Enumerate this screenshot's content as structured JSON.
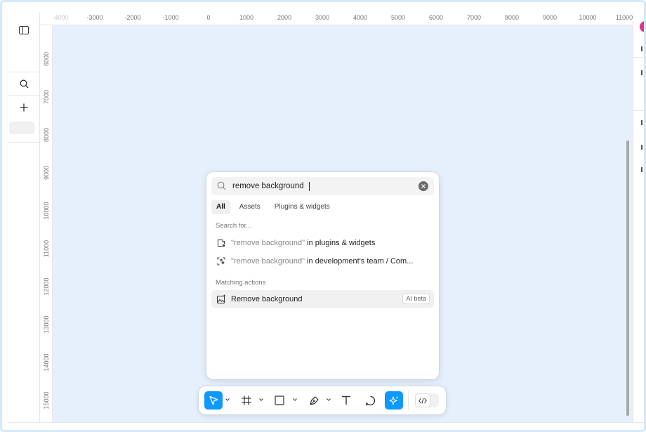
{
  "ruler": {
    "top_ticks": [
      "-4000",
      "-3000",
      "-2000",
      "-1000",
      "0",
      "1000",
      "2000",
      "3000",
      "4000",
      "5000",
      "6000",
      "7000",
      "8000",
      "9000",
      "10000",
      "11000"
    ],
    "left_ticks": [
      "6000",
      "7000",
      "8000",
      "9000",
      "10000",
      "11000",
      "12000",
      "13000",
      "14000",
      "15000"
    ]
  },
  "left_panel": {
    "icons": [
      "panel-toggle-icon",
      "search-icon",
      "plus-icon"
    ]
  },
  "search": {
    "query": "remove background",
    "placeholder": "",
    "tabs": [
      {
        "label": "All",
        "active": true
      },
      {
        "label": "Assets",
        "active": false
      },
      {
        "label": "Plugins & widgets",
        "active": false
      }
    ],
    "search_for_label": "Search for...",
    "search_for_items": [
      {
        "icon": "plugin-icon",
        "quoted": "\"remove background\"",
        "rest": " in plugins & widgets"
      },
      {
        "icon": "component-search-icon",
        "quoted": "\"remove background\"",
        "rest": " in development's team / Com..."
      }
    ],
    "matching_label": "Matching actions",
    "actions": [
      {
        "icon": "image-ai-icon",
        "label": "Remove background",
        "badge": "AI beta"
      }
    ]
  },
  "toolbar": {
    "tools": [
      "move-tool",
      "frame-tool",
      "rectangle-tool",
      "pen-tool",
      "text-tool",
      "comment-tool",
      "actions-tool"
    ],
    "active": "actions-tool",
    "dev_mode_icon": "code-icon"
  },
  "colors": {
    "canvas": "#e5f0fc",
    "accent": "#0d99ff",
    "avatar": "#e0358a"
  }
}
